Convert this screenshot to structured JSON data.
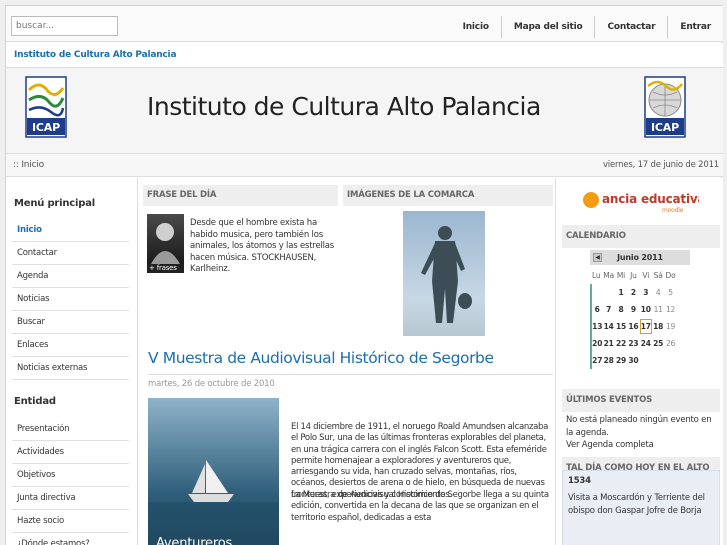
{
  "topbar": {
    "search_placeholder": "buscar...",
    "nav": [
      "Inicio",
      "Mapa del sitio",
      "Contactar",
      "Entrar"
    ]
  },
  "sitebar": {
    "link": "Instituto de Cultura Alto Palancia"
  },
  "header": {
    "title": "Instituto de Cultura Alto Palancia",
    "logo_text": "ICAP"
  },
  "crumbbar": {
    "breadcrumb": ":: Inicio",
    "date": "viernes, 17 de junio de 2011"
  },
  "left": {
    "menu_heading": "Menú principal",
    "menu_items": [
      "Inicio",
      "Contactar",
      "Agenda",
      "Noticias",
      "Buscar",
      "Enlaces",
      "Noticias externas"
    ],
    "entity_heading": "Entidad",
    "entity_items": [
      "Presentación",
      "Actividades",
      "Objetivos",
      "Junta directiva",
      "Hazte socio",
      "¿Dónde estamos?"
    ]
  },
  "center": {
    "frase_heading": "FRASE DEL DÍA",
    "imagenes_heading": "IMÁGENES DE LA COMARCA",
    "frase_tag": "+ frases",
    "frase_text": "Desde que el hombre exista ha habido musica, pero también los animales, los átomos y las estrellas hacen música. STOCKHAUSEN, Karlheinz.",
    "article_title": "V Muestra de Audiovisual Histórico de Segorbe",
    "article_date": "martes, 26 de octubre de 2010",
    "article_img_text": "Aventureros",
    "para1": " El 14 diciembre de 1911, el noruego Roald Amundsen alcanzaba el Polo Sur, una de las últimas fronteras explorables del planeta, en una trágica carrera con el inglés Falcon Scott. Esta efeméride permite homenajear a exploradores y aventureros que, arriesgando su vida, han cruzado selvas, montañas, ríos, océanos, desiertos de arena o de hielo, en búsqueda de nuevas fronteras, experiencias y conocimientos.",
    "para2": "La Muestra de Audiovisual Histórico de Segorbe llega a su quinta edición, convertida en la decana de las que se organizan en el territorio español, dedicadas a esta"
  },
  "right": {
    "moodle_text": "ancia educativa",
    "calendar_heading": "CALENDARIO",
    "calendar_month": "Junio 2011",
    "calendar_days": [
      "Lu",
      "Ma",
      "Mi",
      "Ju",
      "Vi",
      "Sá",
      "Do"
    ],
    "calendar_weeks": [
      [
        "",
        "",
        "1",
        "2",
        "3",
        "4",
        "5"
      ],
      [
        "6",
        "7",
        "8",
        "9",
        "10",
        "11",
        "12"
      ],
      [
        "13",
        "14",
        "15",
        "16",
        "17",
        "18",
        "19"
      ],
      [
        "20",
        "21",
        "22",
        "23",
        "24",
        "25",
        "26"
      ],
      [
        "27",
        "28",
        "29",
        "30",
        "",
        "",
        ""
      ]
    ],
    "events_heading": "ÚLTIMOS EVENTOS",
    "events_text": "No está planeado ningún evento en la agenda.",
    "events_link": "Ver Agenda completa",
    "tal_dia_heading": "TAL DÍA COMO HOY EN EL ALTO PALANCIA",
    "tal_dia_year": "1534",
    "tal_dia_text": "Visita a Moscardón y Terriente del obispo don Gaspar Jofre de Borja"
  }
}
